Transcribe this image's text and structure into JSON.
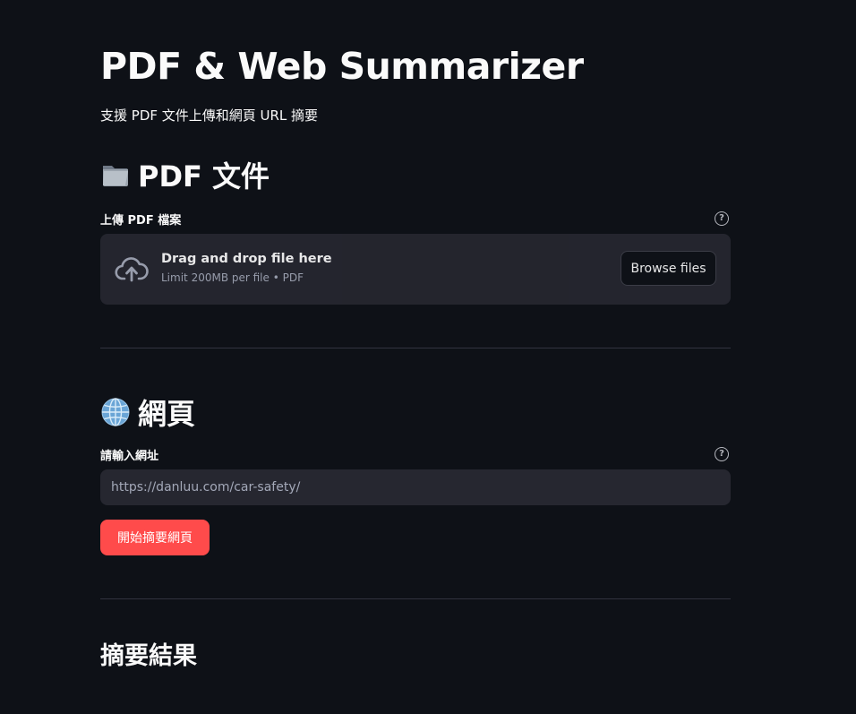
{
  "app": {
    "title": "PDF & Web Summarizer",
    "subtitle": "支援 PDF 文件上傳和網頁 URL 摘要"
  },
  "pdf_section": {
    "icon": "folder-icon",
    "heading": "PDF 文件",
    "uploader": {
      "label": "上傳 PDF 檔案",
      "help_icon": "help-circle-icon",
      "upload_icon": "cloud-upload-icon",
      "drop_text": "Drag and drop file here",
      "limit_text": "Limit 200MB per file • PDF",
      "browse_label": "Browse files"
    }
  },
  "web_section": {
    "icon": "globe-icon",
    "heading": "網頁",
    "url_input": {
      "label": "請輸入網址",
      "help_icon": "help-circle-icon",
      "value": "https://danluu.com/car-safety/"
    },
    "submit_label": "開始摘要網頁"
  },
  "results": {
    "heading": "摘要結果"
  },
  "colors": {
    "background": "#0e1117",
    "surface": "#262730",
    "primary": "#ff4b4b",
    "text": "#fafafa",
    "muted": "#a3a8b8",
    "divider": "#31333f"
  }
}
